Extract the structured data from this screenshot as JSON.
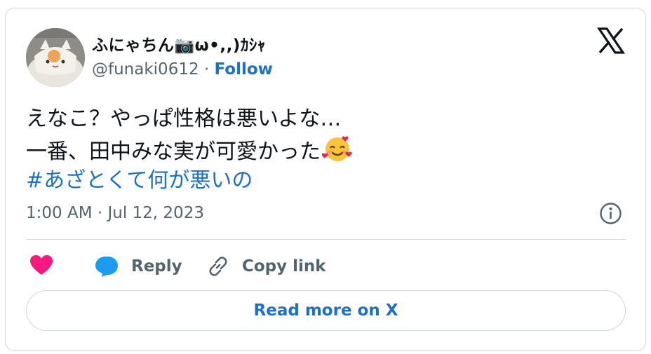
{
  "author": {
    "display_name": "ふにゃちん📷ω•,,)ｶｼｬ",
    "handle": "@funaki0612",
    "separator": "·",
    "follow_label": "Follow"
  },
  "tweet": {
    "line1": "えなこ？やっぱ性格は悪いよな…",
    "line2": "一番、田中みな実が可愛かった",
    "hashtag": "#あざとくて何が悪いの",
    "emoji": "smiling-face-with-hearts"
  },
  "timestamp": "1:00 AM · Jul 12, 2023",
  "actions": {
    "like_icon": "heart-icon",
    "reply_label": "Reply",
    "copy_label": "Copy link"
  },
  "read_more_label": "Read more on X",
  "colors": {
    "link": "#1d70c9",
    "heart": "#f91880",
    "reply_icon": "#1d9bf0",
    "border": "#cfd9de",
    "muted": "#536471"
  }
}
